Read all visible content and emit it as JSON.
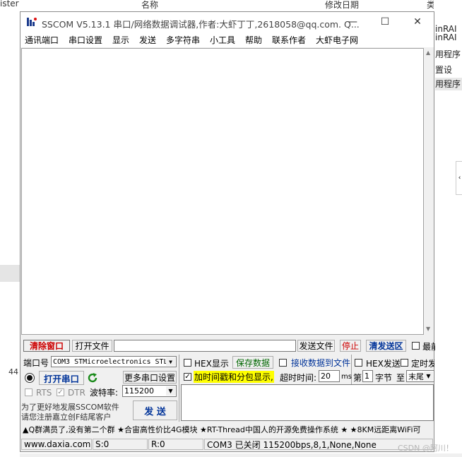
{
  "background": {
    "left_top": "ister",
    "left_mid": "44",
    "col_name": "名称",
    "col_date": "修改日期",
    "col_type": "类型",
    "right_rows": [
      "inRAI",
      "inRAI",
      "用程序",
      "置设",
      "用程序"
    ]
  },
  "window": {
    "title": "SSCOM V5.13.1 串口/网络数据调试器,作者:大虾丁丁,2618058@qq.com. Q...",
    "minimize": "—",
    "maximize": "☐",
    "close": "✕"
  },
  "menu": [
    "通讯端口",
    "串口设置",
    "显示",
    "发送",
    "多字符串",
    "小工具",
    "帮助",
    "联系作者",
    "大虾电子网"
  ],
  "toolbar": {
    "clear_window": "清除窗口",
    "open_file": "打开文件",
    "file_path": "",
    "send_file": "发送文件",
    "stop": "停止",
    "clear_send": "清发送区",
    "last_label": "最前"
  },
  "port": {
    "port_label": "端口号",
    "port_value": "COM3 STMicroelectronics STL",
    "open_port": "打开串口",
    "more_settings": "更多串口设置",
    "rts": "RTS",
    "dtr": "DTR",
    "baud_label": "波特率:",
    "baud_value": "115200",
    "promo_line1": "为了更好地发展SSCOM软件",
    "promo_line2": "请您注册嘉立创F结尾客户",
    "send": "发 送"
  },
  "options": {
    "hex_display": "HEX显示",
    "save_data": "保存数据",
    "recv_to_file": "接收数据到文件",
    "hex_send": "HEX发送",
    "timed_send": "定时发",
    "timestamp": "加时间戳和分包显示,",
    "timeout_label": "超时时间:",
    "timeout_value": "20",
    "ms": "ms",
    "nth_label": "第",
    "nth_value": "1",
    "byte_label": "字节",
    "to_label": "至",
    "end_value": "末尾"
  },
  "ticker": "▲Q群满员了,没有第二个群 ★合宙高性价比4G模块 ★RT-Thread中国人的开源免费操作系统 ★ ★8KM远距离WiFi可",
  "status": {
    "site": "www.daxia.com",
    "sent": "S:0",
    "received": "R:0",
    "port_state": "COM3 已关闭  115200bps,8,1,None,None"
  },
  "watermark": "CSDN @阿川！",
  "colors": {
    "clear_red": "#cc0000",
    "save_green": "#006600",
    "clear_send_blue": "#003399",
    "timestamp_bg": "#ffff00",
    "led": "#111111"
  }
}
